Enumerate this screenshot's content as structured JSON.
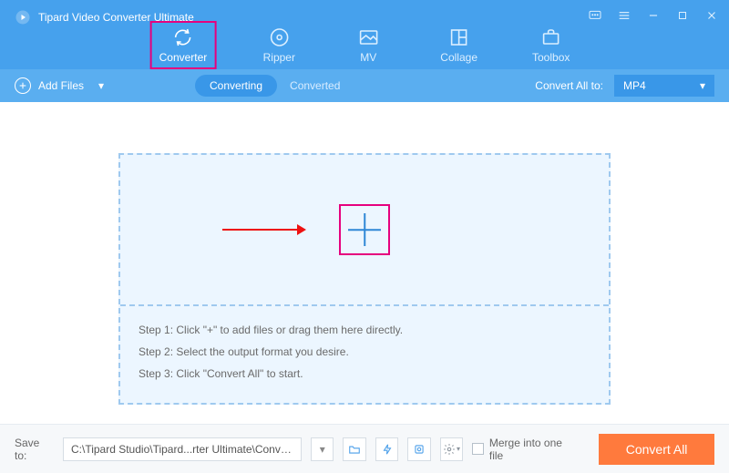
{
  "header": {
    "app_title": "Tipard Video Converter Ultimate",
    "tabs": [
      {
        "label": "Converter",
        "icon": "refresh-icon",
        "active": true,
        "highlighted": true
      },
      {
        "label": "Ripper",
        "icon": "disc-icon"
      },
      {
        "label": "MV",
        "icon": "image-icon"
      },
      {
        "label": "Collage",
        "icon": "grid-icon"
      },
      {
        "label": "Toolbox",
        "icon": "briefcase-icon"
      }
    ]
  },
  "subbar": {
    "add_files_label": "Add Files",
    "view_tabs": {
      "converting": "Converting",
      "converted": "Converted"
    },
    "convert_all_label": "Convert All to:",
    "format_selected": "MP4"
  },
  "drop": {
    "step1": "Step 1: Click \"+\" to add files or drag them here directly.",
    "step2": "Step 2: Select the output format you desire.",
    "step3": "Step 3: Click \"Convert All\" to start."
  },
  "footer": {
    "save_to_label": "Save to:",
    "save_path": "C:\\Tipard Studio\\Tipard...rter Ultimate\\Converted",
    "merge_label": "Merge into one file",
    "convert_btn": "Convert All"
  }
}
